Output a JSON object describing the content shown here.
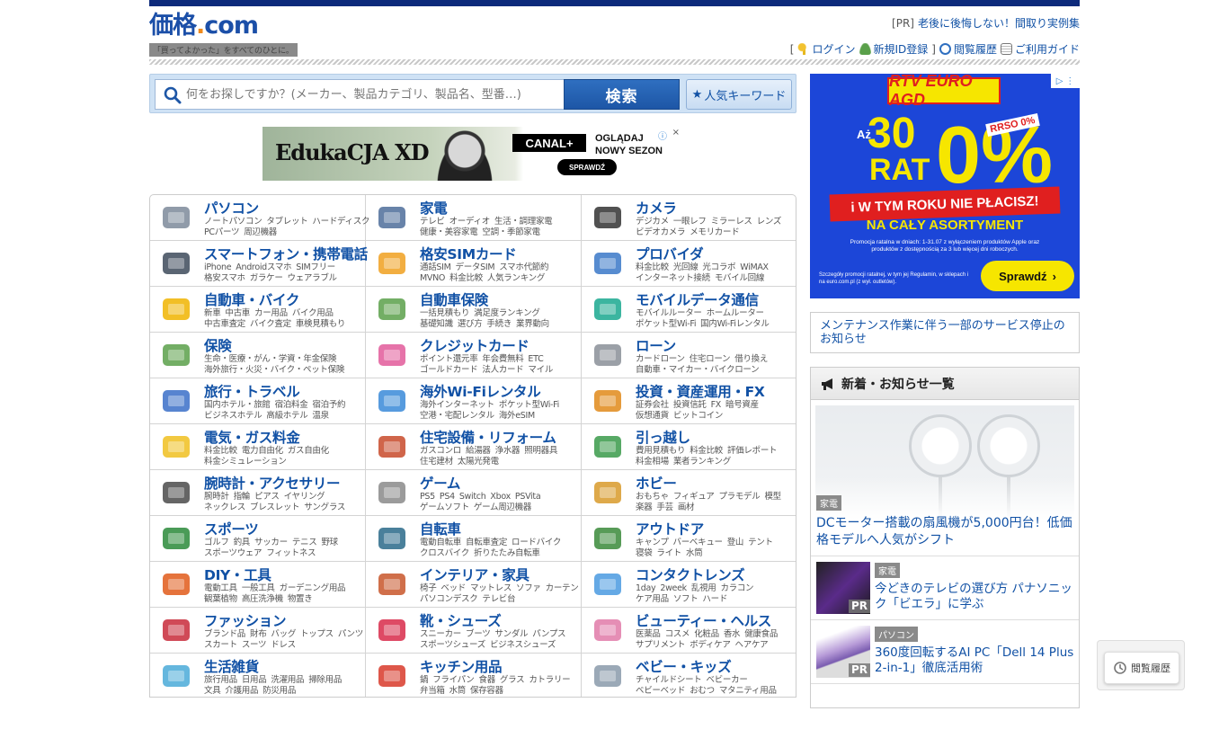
{
  "logo": {
    "word_main": "価格",
    "word_dot": ".",
    "word_com": "com",
    "tagline": "「買ってよかった」をすべてのひとに。"
  },
  "pr": {
    "label": "[PR]",
    "link": "老後に後悔しない！間取り実例集"
  },
  "user_nav": {
    "open_bracket": "[",
    "login": "ログイン",
    "register": "新規ID登録",
    "close_bracket": "]",
    "history": "閲覧履歴",
    "guide": "ご利用ガイド"
  },
  "search": {
    "placeholder": "何をお探しですか？(メーカー、製品カテゴリ、製品名、型番…)",
    "button": "検索",
    "popular": "人気キーワード"
  },
  "banner_ad": {
    "edu": "EdukaCJA XD",
    "canal": "CANAL+",
    "line1": "OGLĄDAJ",
    "line2": "NOWY SEZON",
    "cta": "SPRAWDŹ"
  },
  "categories": [
    {
      "title": "パソコン",
      "icon": "laptop-icon",
      "sub1": [
        "ノートパソコン",
        "タブレット",
        "ハードディスク"
      ],
      "sub2": [
        "PCパーツ",
        "周辺機器"
      ]
    },
    {
      "title": "家電",
      "icon": "tv-icon",
      "sub1": [
        "テレビ",
        "オーディオ",
        "生活・調理家電"
      ],
      "sub2": [
        "健康・美容家電",
        "空調・季節家電"
      ]
    },
    {
      "title": "カメラ",
      "icon": "camera-icon",
      "sub1": [
        "デジカメ",
        "一眼レフ",
        "ミラーレス",
        "レンズ"
      ],
      "sub2": [
        "ビデオカメラ",
        "メモリカード"
      ]
    },
    {
      "title": "スマートフォン・携帯電話",
      "icon": "smartphone-icon",
      "sub1": [
        "iPhone",
        "Androidスマホ",
        "SIMフリー"
      ],
      "sub2": [
        "格安スマホ",
        "ガラケー",
        "ウェアラブル"
      ]
    },
    {
      "title": "格安SIMカード",
      "icon": "sim-card-icon",
      "sub1": [
        "通話SIM",
        "データSIM",
        "スマホ代節約"
      ],
      "sub2": [
        "MVNO",
        "料金比較",
        "人気ランキング"
      ]
    },
    {
      "title": "プロバイダ",
      "icon": "globe-icon",
      "sub1": [
        "料金比較",
        "光回線",
        "光コラボ",
        "WiMAX"
      ],
      "sub2": [
        "インターネット接続",
        "モバイル回線"
      ]
    },
    {
      "title": "自動車・バイク",
      "icon": "car-icon",
      "sub1": [
        "新車",
        "中古車",
        "カー用品",
        "バイク用品"
      ],
      "sub2": [
        "中古車査定",
        "バイク査定",
        "車検見積もり"
      ]
    },
    {
      "title": "自動車保険",
      "icon": "car-insurance-icon",
      "sub1": [
        "一括見積もり",
        "満足度ランキング"
      ],
      "sub2": [
        "基礎知識",
        "選び方",
        "手続き",
        "業界動向"
      ]
    },
    {
      "title": "モバイルデータ通信",
      "icon": "wifi-icon",
      "sub1": [
        "モバイルルーター",
        "ホームルーター"
      ],
      "sub2": [
        "ポケット型Wi-Fi",
        "国内Wi-Fiレンタル"
      ]
    },
    {
      "title": "保険",
      "icon": "clover-icon",
      "sub1": [
        "生命・医療・がん・学資・年金保険"
      ],
      "sub2": [
        "海外旅行・火災・バイク・ペット保険"
      ]
    },
    {
      "title": "クレジットカード",
      "icon": "credit-card-icon",
      "sub1": [
        "ポイント還元率",
        "年会費無料",
        "ETC"
      ],
      "sub2": [
        "ゴールドカード",
        "法人カード",
        "マイル"
      ]
    },
    {
      "title": "ローン",
      "icon": "calculator-icon",
      "sub1": [
        "カードローン",
        "住宅ローン",
        "借り換え"
      ],
      "sub2": [
        "自動車・マイカー・バイクローン"
      ]
    },
    {
      "title": "旅行・トラベル",
      "icon": "airplane-icon",
      "sub1": [
        "国内ホテル・旅館",
        "宿泊料金",
        "宿泊予約"
      ],
      "sub2": [
        "ビジネスホテル",
        "高級ホテル",
        "温泉"
      ]
    },
    {
      "title": "海外Wi-Fiレンタル",
      "icon": "wifi-plane-icon",
      "sub1": [
        "海外インターネット",
        "ポケット型Wi-Fi"
      ],
      "sub2": [
        "空港・宅配レンタル",
        "海外eSIM"
      ]
    },
    {
      "title": "投資・資産運用・FX",
      "icon": "chart-yen-icon",
      "sub1": [
        "証券会社",
        "投資信託",
        "FX",
        "暗号資産"
      ],
      "sub2": [
        "仮想通貨",
        "ビットコイン"
      ]
    },
    {
      "title": "電気・ガス料金",
      "icon": "lightbulb-icon",
      "sub1": [
        "料金比較",
        "電力自由化",
        "ガス自由化"
      ],
      "sub2": [
        "料金シミュレーション"
      ]
    },
    {
      "title": "住宅設備・リフォーム",
      "icon": "house-icon",
      "sub1": [
        "ガスコンロ",
        "給湯器",
        "浄水器",
        "照明器具"
      ],
      "sub2": [
        "住宅建材",
        "太陽光発電"
      ]
    },
    {
      "title": "引っ越し",
      "icon": "truck-icon",
      "sub1": [
        "費用見積もり",
        "料金比較",
        "評価レポート"
      ],
      "sub2": [
        "料金相場",
        "業者ランキング"
      ]
    },
    {
      "title": "腕時計・アクセサリー",
      "icon": "watch-icon",
      "sub1": [
        "腕時計",
        "指輪",
        "ピアス",
        "イヤリング"
      ],
      "sub2": [
        "ネックレス",
        "ブレスレット",
        "サングラス"
      ]
    },
    {
      "title": "ゲーム",
      "icon": "gamepad-icon",
      "sub1": [
        "PS5",
        "PS4",
        "Switch",
        "Xbox",
        "PSVita"
      ],
      "sub2": [
        "ゲームソフト",
        "ゲーム周辺機器"
      ]
    },
    {
      "title": "ホビー",
      "icon": "robot-toy-icon",
      "sub1": [
        "おもちゃ",
        "フィギュア",
        "プラモデル",
        "模型"
      ],
      "sub2": [
        "楽器",
        "手芸",
        "画材"
      ]
    },
    {
      "title": "スポーツ",
      "icon": "golf-icon",
      "sub1": [
        "ゴルフ",
        "釣具",
        "サッカー",
        "テニス",
        "野球"
      ],
      "sub2": [
        "スポーツウェア",
        "フィットネス"
      ]
    },
    {
      "title": "自転車",
      "icon": "bicycle-icon",
      "sub1": [
        "電動自転車",
        "自転車査定",
        "ロードバイク"
      ],
      "sub2": [
        "クロスバイク",
        "折りたたみ自転車"
      ]
    },
    {
      "title": "アウトドア",
      "icon": "mountain-icon",
      "sub1": [
        "キャンプ",
        "バーベキュー",
        "登山",
        "テント"
      ],
      "sub2": [
        "寝袋",
        "ライト",
        "水筒"
      ]
    },
    {
      "title": "DIY・工具",
      "icon": "drill-icon",
      "sub1": [
        "電動工具",
        "一般工具",
        "ガーデニング用品"
      ],
      "sub2": [
        "観葉植物",
        "高圧洗浄機",
        "物置き"
      ]
    },
    {
      "title": "インテリア・家具",
      "icon": "chair-icon",
      "sub1": [
        "椅子",
        "ベッド",
        "マットレス",
        "ソファ",
        "カーテン"
      ],
      "sub2": [
        "パソコンデスク",
        "テレビ台"
      ]
    },
    {
      "title": "コンタクトレンズ",
      "icon": "contact-lens-icon",
      "sub1": [
        "1day",
        "2week",
        "乱視用",
        "カラコン"
      ],
      "sub2": [
        "ケア用品",
        "ソフト",
        "ハード"
      ]
    },
    {
      "title": "ファッション",
      "icon": "jacket-icon",
      "sub1": [
        "ブランド品",
        "財布",
        "バッグ",
        "トップス",
        "パンツ"
      ],
      "sub2": [
        "スカート",
        "スーツ",
        "ドレス"
      ]
    },
    {
      "title": "靴・シューズ",
      "icon": "shoe-icon",
      "sub1": [
        "スニーカー",
        "ブーツ",
        "サンダル",
        "パンプス"
      ],
      "sub2": [
        "スポーツシューズ",
        "ビジネスシューズ"
      ]
    },
    {
      "title": "ビューティー・ヘルス",
      "icon": "cosmetics-icon",
      "sub1": [
        "医薬品",
        "コスメ",
        "化粧品",
        "香水",
        "健康食品"
      ],
      "sub2": [
        "サプリメント",
        "ボディケア",
        "ヘアケア"
      ]
    },
    {
      "title": "生活雑貨",
      "icon": "spray-bottle-icon",
      "sub1": [
        "旅行用品",
        "日用品",
        "洗濯用品",
        "掃除用品"
      ],
      "sub2": [
        "文具",
        "介護用品",
        "防災用品"
      ]
    },
    {
      "title": "キッチン用品",
      "icon": "pot-icon",
      "sub1": [
        "鍋",
        "フライパン",
        "食器",
        "グラス",
        "カトラリー"
      ],
      "sub2": [
        "弁当箱",
        "水筒",
        "保存容器"
      ]
    },
    {
      "title": "ベビー・キッズ",
      "icon": "stroller-icon",
      "sub1": [
        "チャイルドシート",
        "ベビーカー"
      ],
      "sub2": [
        "ベビーベッド",
        "おむつ",
        "マタニティ用品"
      ]
    }
  ],
  "side_ad": {
    "brand": "RTV EURO AGD",
    "az": "Aż",
    "num": "30",
    "rat": "RAT",
    "zero": "0%",
    "rrso": "RRSO 0%",
    "headline": "i W TYM ROKU NIE PŁACISZ!",
    "sub": "NA CAŁY ASORTYMENT",
    "promo": "Promocja ratalna w dniach: 1-31.07 z wyłączeniem produktów Apple oraz produktów z dostępnością za 3 lub więcej dni roboczych.",
    "fine": "Szczegóły promocji ratalnej, w tym jej Regulamin, w sklepach i na euro.com.pl (z wył. outletów).",
    "cta": "Sprawdź"
  },
  "maintenance": {
    "text": "メンテナンス作業に伴う一部のサービス停止のお知らせ"
  },
  "news": {
    "heading": "新着・お知らせ一覧",
    "feature": {
      "tag": "家電",
      "title": "DCモーター搭載の扇風機が5,000円台！低価格モデルへ人気がシフト"
    },
    "items": [
      {
        "tag": "家電",
        "title": "今どきのテレビの選び方 パナソニック「ビエラ」に学ぶ",
        "pr": "PR"
      },
      {
        "tag": "パソコン",
        "title": "360度回転するAI PC「Dell 14 Plus 2-in-1」徹底活用術",
        "pr": "PR"
      }
    ]
  },
  "history_float": {
    "label": "閲覧履歴"
  },
  "colors": {
    "brand_blue": "#1151a5",
    "top_bar": "#0d2a7b",
    "accent_orange": "#f08a1c"
  }
}
